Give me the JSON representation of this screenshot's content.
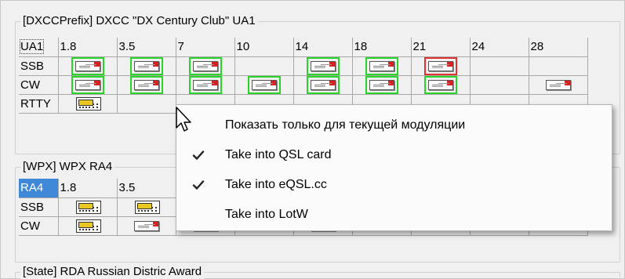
{
  "groups": [
    {
      "title": "[DXCCPrefix] DXCC \"DX Century Club\" UA1",
      "header": [
        "UA1",
        "1.8",
        "3.5",
        "7",
        "10",
        "14",
        "18",
        "21",
        "24",
        "28"
      ],
      "rows": [
        {
          "label": "SSB",
          "cells": [
            "card-green",
            "card-green",
            "card-green",
            "",
            "card-green",
            "card-green",
            "card-red",
            "",
            ""
          ]
        },
        {
          "label": "CW",
          "cells": [
            "card-green",
            "card-green",
            "card-green",
            "card-green",
            "card-green",
            "card-green",
            "card-green",
            "",
            "card"
          ]
        },
        {
          "label": "RTTY",
          "cells": [
            "radio",
            "",
            "",
            "",
            "",
            "",
            "",
            "",
            ""
          ]
        }
      ]
    },
    {
      "title": "[WPX] WPX RA4",
      "header": [
        "RA4",
        "1.8",
        "3.5",
        "",
        "",
        "",
        "",
        "",
        "",
        ""
      ],
      "rows": [
        {
          "label": "SSB",
          "cells": [
            "radio",
            "radio",
            "",
            "",
            "",
            "",
            "",
            "",
            ""
          ]
        },
        {
          "label": "CW",
          "cells": [
            "radio",
            "card",
            "card",
            "",
            "card",
            "",
            "",
            "",
            ""
          ]
        }
      ]
    },
    {
      "title": "[State] RDA Russian Distric Award"
    }
  ],
  "context_menu": {
    "items": [
      {
        "label": "Показать только для текущей модуляции",
        "checked": false
      },
      {
        "label": "Take into  QSL card",
        "checked": true
      },
      {
        "label": "Take into eQSL.cc",
        "checked": true
      },
      {
        "label": "Take into LotW",
        "checked": false
      }
    ]
  },
  "icons": {
    "qsl_card": "qsl-card-icon",
    "radio": "radio-icon",
    "check": "checkmark-icon",
    "cursor": "mouse-pointer-icon"
  },
  "colors": {
    "confirmed_border": "#28d428",
    "unconfirmed_border": "#e03030",
    "selected_cell": "#3f88d8"
  }
}
